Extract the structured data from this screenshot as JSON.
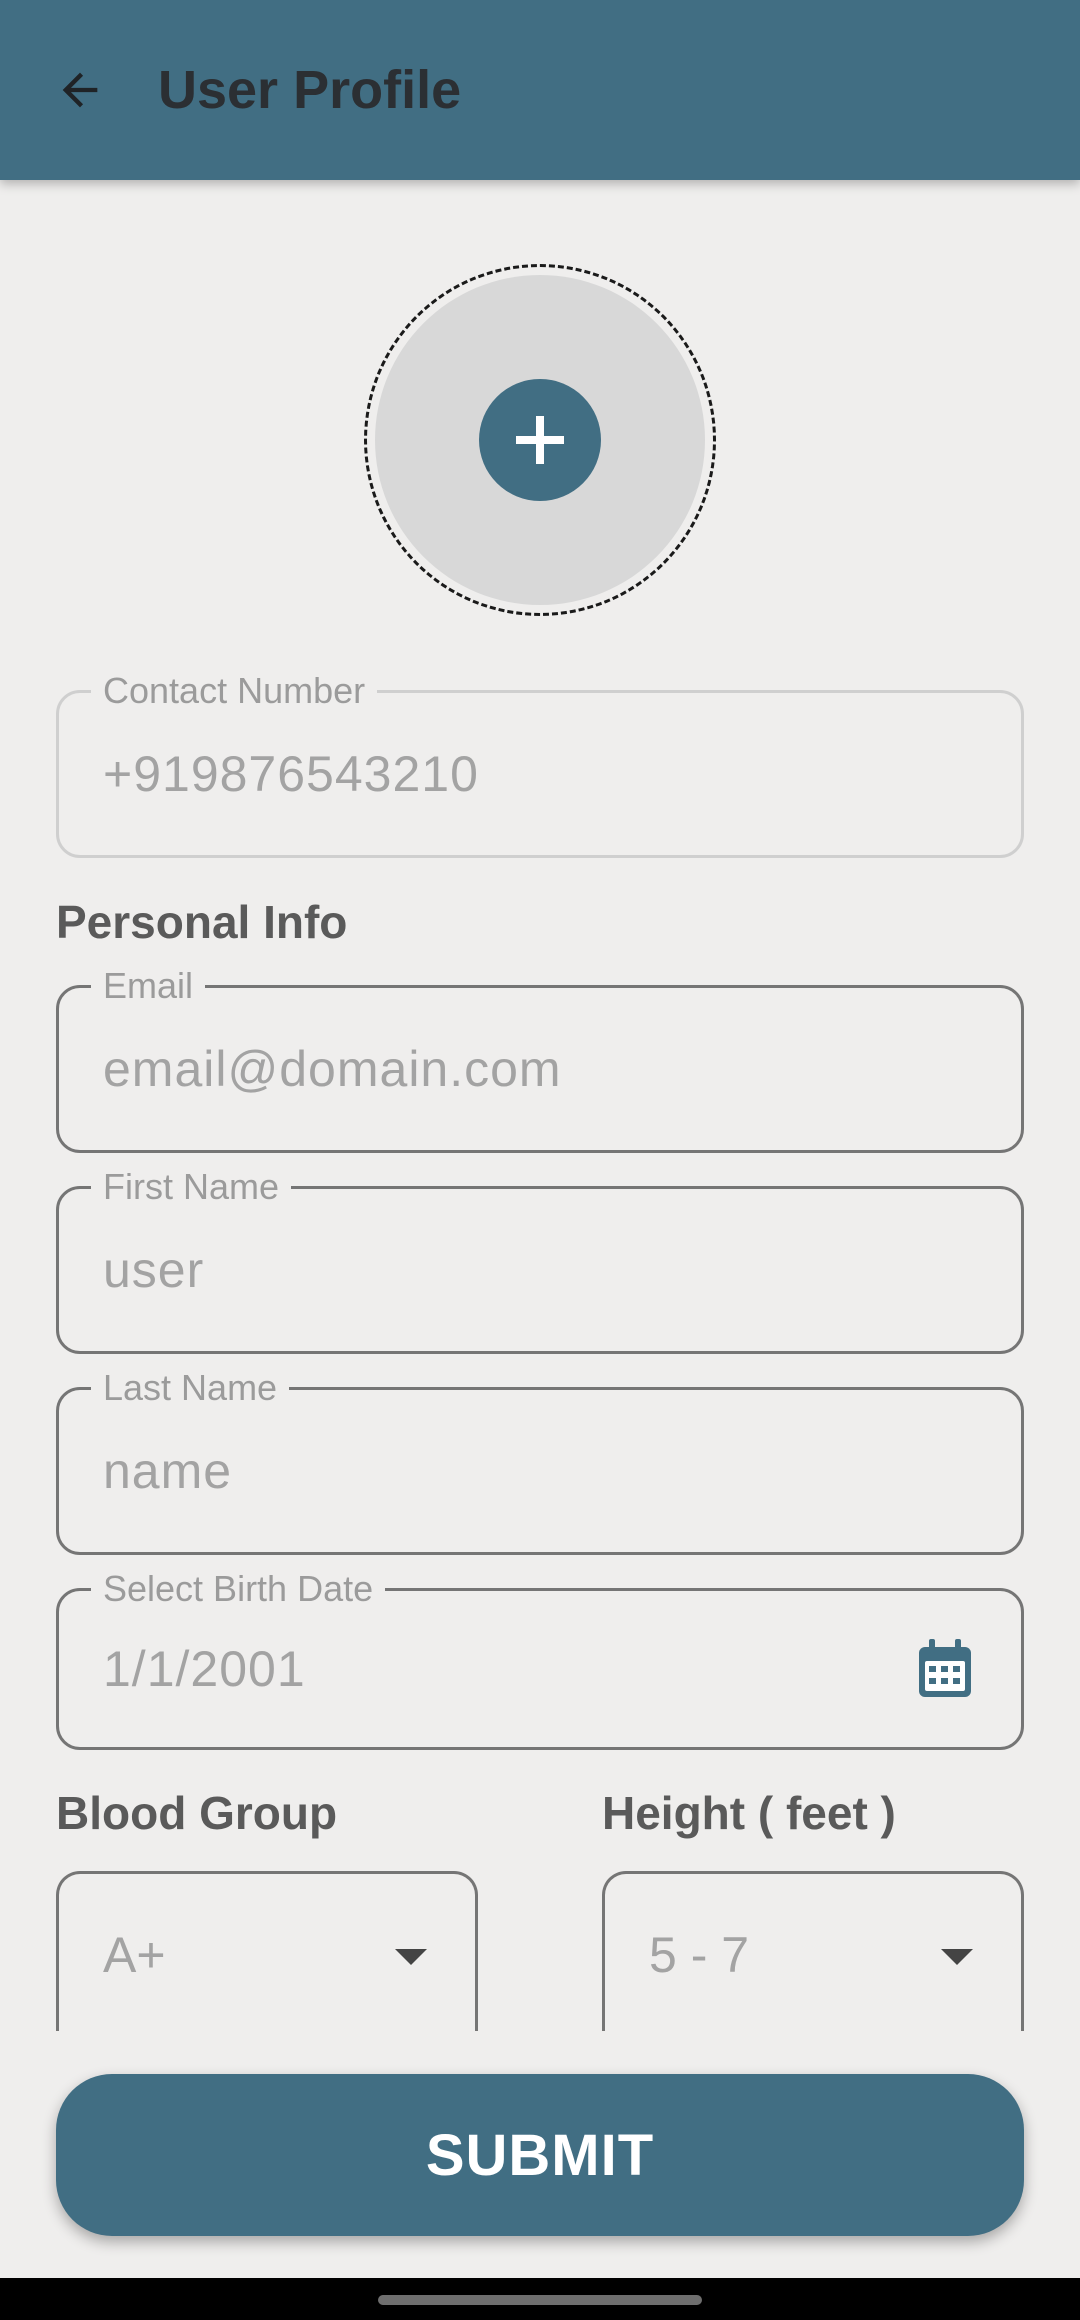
{
  "appbar": {
    "title": "User Profile",
    "back_icon": "arrow-left-icon"
  },
  "avatar": {
    "add_icon": "plus-icon"
  },
  "contact": {
    "label": "Contact Number",
    "value": "+919876543210"
  },
  "personal_info": {
    "heading": "Personal Info"
  },
  "email": {
    "label": "Email",
    "value": "email@domain.com"
  },
  "first_name": {
    "label": "First Name",
    "value": "user"
  },
  "last_name": {
    "label": "Last Name",
    "value": "name"
  },
  "birth_date": {
    "label": "Select Birth Date",
    "value": "1/1/2001",
    "icon": "calendar-icon"
  },
  "blood_group": {
    "heading": "Blood Group",
    "selected": "A+"
  },
  "height": {
    "heading": "Height ( feet )",
    "selected": "5 - 7"
  },
  "submit": {
    "label": "SUBMIT"
  },
  "colors": {
    "primary": "#416e83",
    "background": "#efeeed",
    "avatar_fill": "#d8d8d8"
  }
}
